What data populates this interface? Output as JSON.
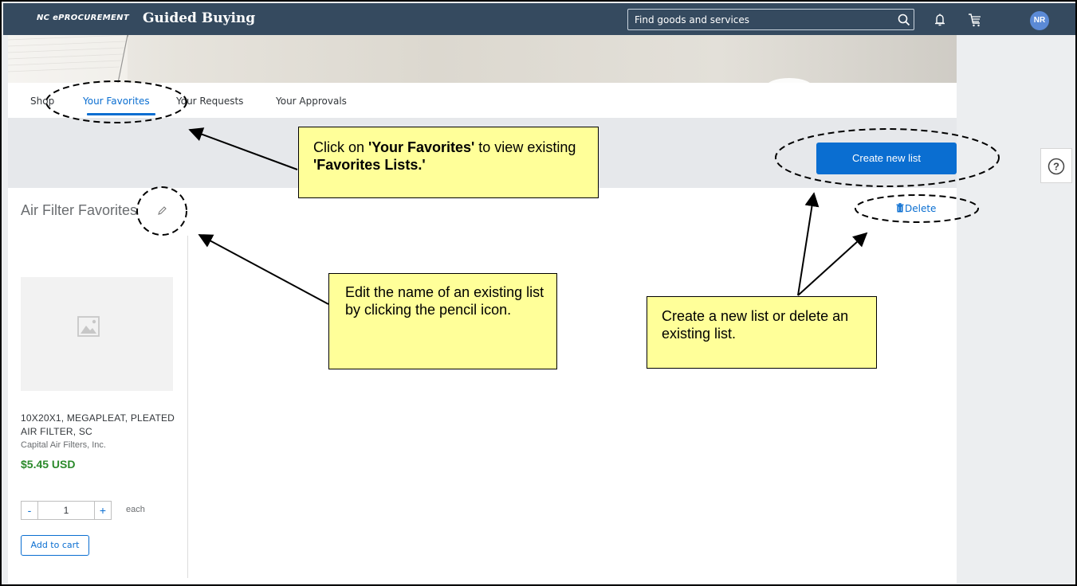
{
  "header": {
    "brand_small": "NC ePROCUREMENT",
    "title": "Guided Buying",
    "search_placeholder": "Find goods and services",
    "avatar_initials": "NR",
    "icons": [
      "search-icon",
      "bell-icon",
      "cart-icon"
    ]
  },
  "tabs": [
    {
      "label": "Shop",
      "active": false
    },
    {
      "label": "Your Favorites",
      "active": true
    },
    {
      "label": "Your Requests",
      "active": false
    },
    {
      "label": "Your Approvals",
      "active": false
    }
  ],
  "actions": {
    "create_new_list": "Create new list",
    "delete": "Delete",
    "help": "?"
  },
  "list": {
    "title": "Air Filter Favorites",
    "items": [
      {
        "name": "10X20X1, MEGAPLEAT, PLEATED AIR FILTER, SC",
        "supplier": "Capital Air Filters, Inc.",
        "price": "$5.45 USD",
        "quantity": "1",
        "unit": "each",
        "qty_minus": "-",
        "qty_plus": "+",
        "add_to_cart": "Add to cart"
      }
    ]
  },
  "callouts": {
    "favorites": {
      "pre": "Click on ",
      "strong1": "'Your Favorites'",
      "mid": " to view existing ",
      "strong2": "'Favorites Lists.'"
    },
    "edit_name": "Edit the name of an existing list by clicking the pencil icon.",
    "create_delete": "Create a new list or delete an existing list."
  },
  "colors": {
    "topbar": "#354a5f",
    "accent": "#0a6ed1",
    "price": "#2b8a2b",
    "callout": "#ffff99"
  }
}
